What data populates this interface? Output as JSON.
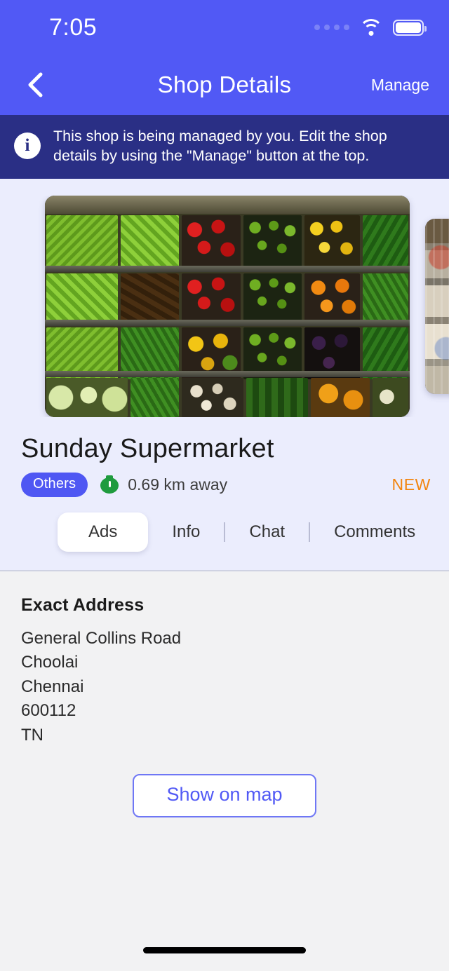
{
  "status_bar": {
    "time": "7:05",
    "signal_icon": "signal-dots-icon",
    "wifi_icon": "wifi-icon",
    "battery_icon": "battery-icon"
  },
  "nav": {
    "back_icon": "back-chevron-icon",
    "title": "Shop Details",
    "action_label": "Manage"
  },
  "info_banner": {
    "icon": "info-circle-icon",
    "message": "This shop is being managed by you. Edit the shop details by using the \"Manage\" button at the top.",
    "background": "#2a2f85"
  },
  "shop": {
    "name": "Sunday Supermarket",
    "category_badge": "Others",
    "distance_icon": "stopwatch-icon",
    "distance": "0.69 km away",
    "status_tag": "NEW",
    "status_tag_color": "#f28510",
    "accent_color": "#5159f5",
    "gallery": [
      {
        "alt": "supermarket-produce-shelves"
      },
      {
        "alt": "supermarket-aisle"
      }
    ]
  },
  "tabs": [
    {
      "label": "Ads",
      "active": true
    },
    {
      "label": "Info",
      "active": false
    },
    {
      "label": "Chat",
      "active": false
    },
    {
      "label": "Comments",
      "active": false
    }
  ],
  "address": {
    "heading": "Exact Address",
    "lines": [
      "General Collins Road",
      "Choolai",
      "Chennai",
      "600112",
      "TN"
    ],
    "map_button": "Show on map"
  }
}
